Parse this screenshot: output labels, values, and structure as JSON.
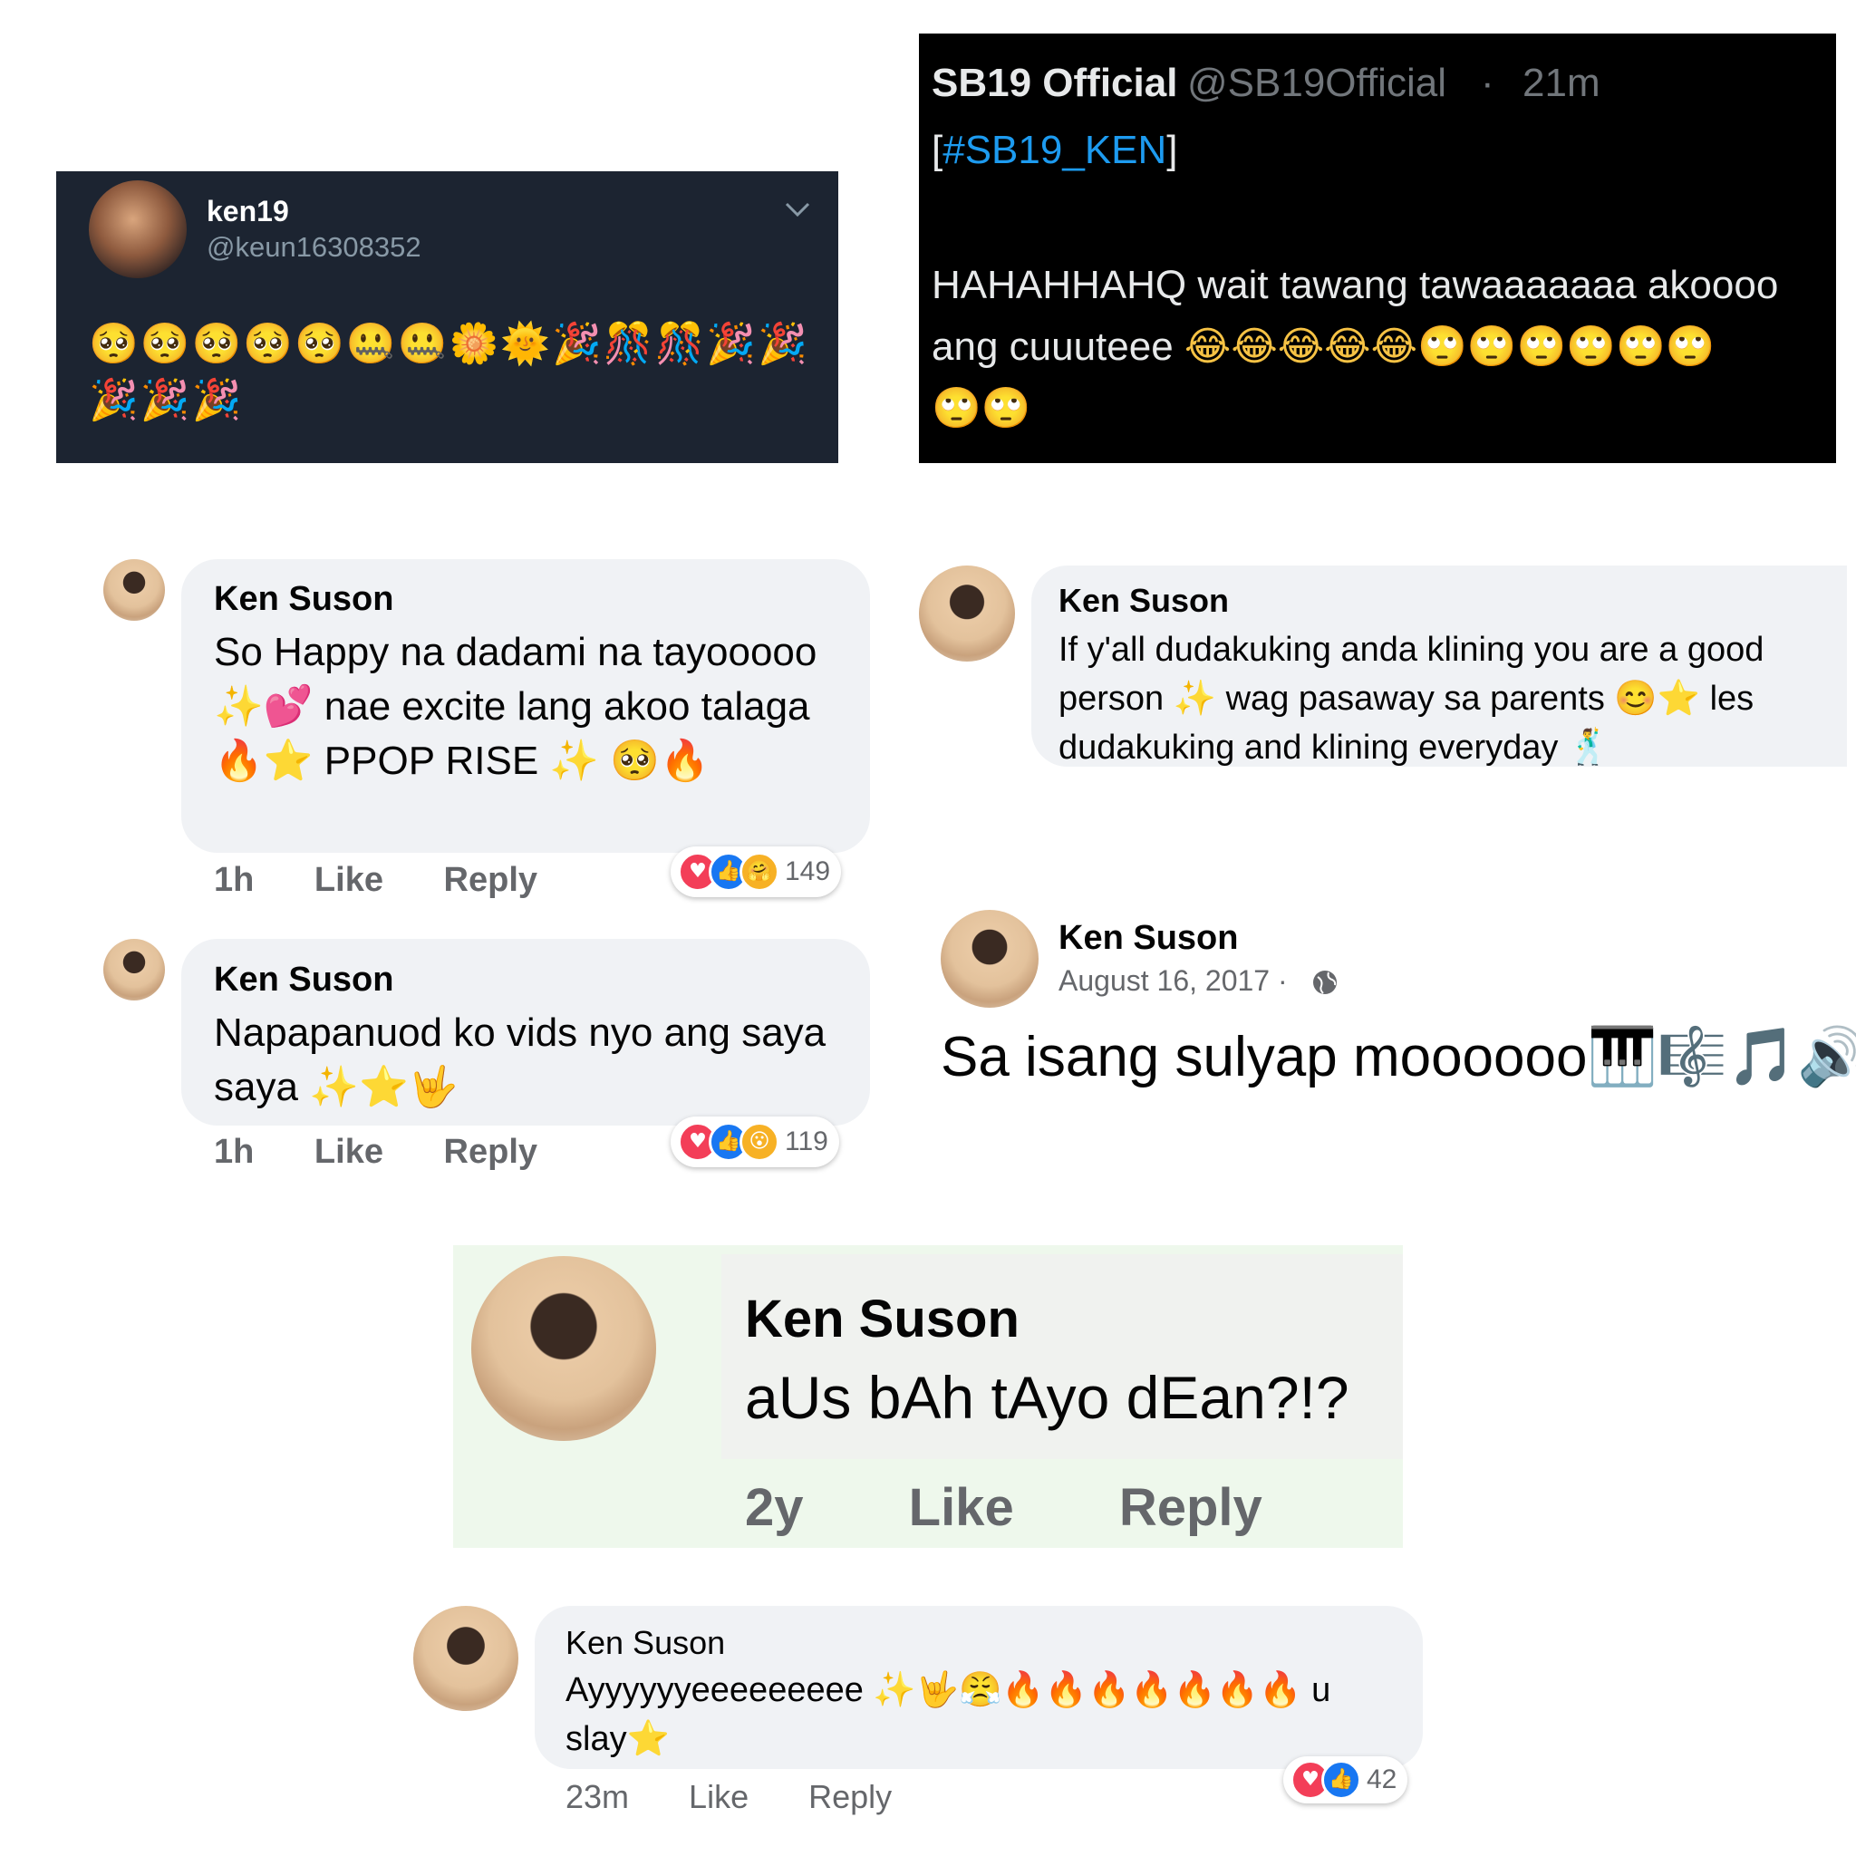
{
  "tweet1": {
    "name": "ken19",
    "handle": "@keun16308352",
    "emojis": "🥺🥺🥺🥺🥺🤐🤐🌼🌞🎉🎊🎊🎉🎉🎉🎉🎉"
  },
  "tweet2": {
    "name": "SB19 Official",
    "handle": "@SB19Official",
    "separator": "·",
    "time": "21m",
    "hashtag_open": "[",
    "hashtag": "#SB19_KEN",
    "hashtag_close": "]",
    "line1": "HAHAHHAHQ wait tawang tawaaaaaaa akoooo",
    "line2_text": "ang cuuuteee ",
    "line2_emojis": "😂😂😂😂😂🙄🙄🙄🙄🙄🙄",
    "line3_emojis": "🙄🙄"
  },
  "commentA": {
    "name": "Ken Suson",
    "text": "So Happy na dadami na tayooooo ✨💕 nae excite lang akoo talaga 🔥⭐ PPOP RISE ✨ 🥺🔥",
    "time": "1h",
    "like": "Like",
    "reply": "Reply",
    "reaction_count": "149"
  },
  "commentB": {
    "name": "Ken Suson",
    "text": "Napapanuod ko vids nyo ang saya saya ✨⭐🤟",
    "time": "1h",
    "like": "Like",
    "reply": "Reply",
    "reaction_count": "119"
  },
  "commentC": {
    "name": "Ken Suson",
    "text": "If y'all dudakuking anda klining you are a good person ✨ wag pasaway sa parents 😊⭐ les dudakuking and klining everyday 🕺"
  },
  "postD": {
    "name": "Ken Suson",
    "date": "August 16, 2017 ·",
    "text": "Sa isang sulyap moooooo🎹🎼🎵🔊🎤"
  },
  "commentE": {
    "name": "Ken Suson",
    "text": "aUs bAh tAyo dEan?!?",
    "time": "2y",
    "like": "Like",
    "reply": "Reply"
  },
  "commentF": {
    "name": "Ken Suson",
    "text": "Ayyyyyyeeeeeeeee ✨🤟😤🔥🔥🔥🔥🔥🔥🔥 u slay⭐",
    "time": "23m",
    "like": "Like",
    "reply": "Reply",
    "reaction_count": "42"
  },
  "colors": {
    "twitter_dark_bg": "#1c2431",
    "twitter_black_bg": "#000000",
    "twitter_link": "#1d9bf0",
    "fb_bubble": "#f0f2f5",
    "fb_meta": "#65676b",
    "heart": "#f33e58",
    "like": "#1877f2"
  }
}
